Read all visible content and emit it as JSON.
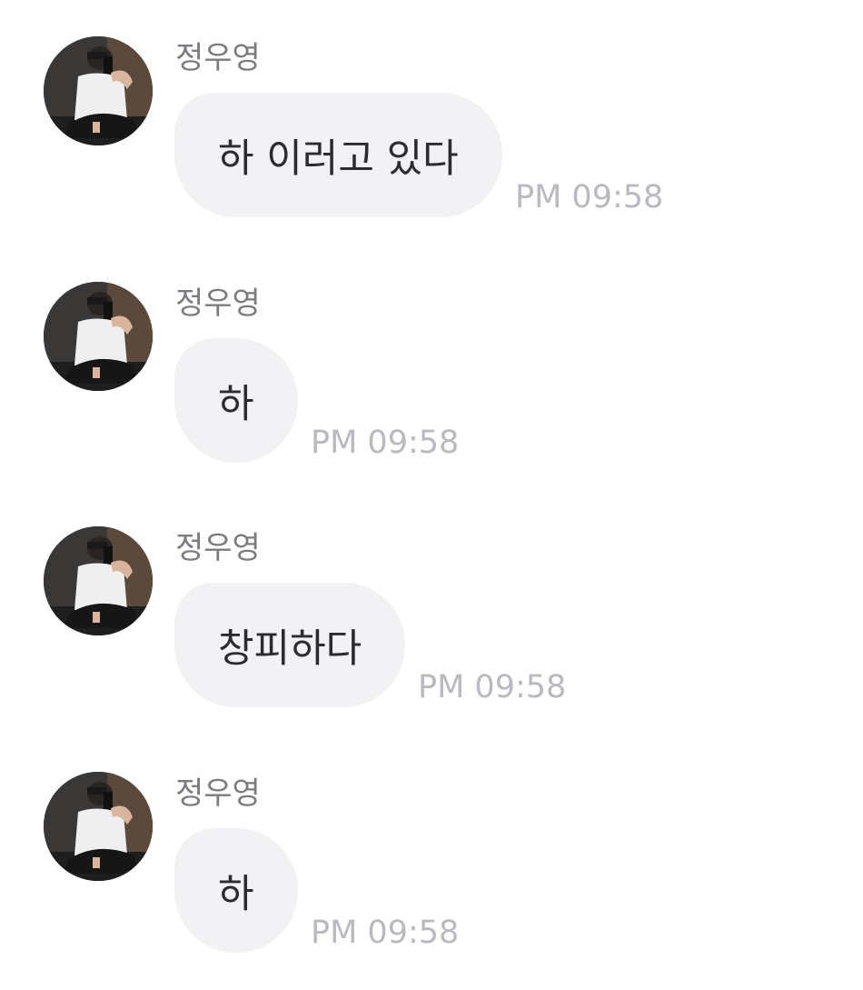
{
  "messages": [
    {
      "sender": "정우영",
      "text": "하 이러고 있다",
      "time": "PM 09:58"
    },
    {
      "sender": "정우영",
      "text": "하",
      "time": "PM 09:58"
    },
    {
      "sender": "정우영",
      "text": "창피하다",
      "time": "PM 09:58"
    },
    {
      "sender": "정우영",
      "text": "하",
      "time": "PM 09:58"
    }
  ],
  "colors": {
    "bubble": "#f2f2f4",
    "sender": "#7b7b80",
    "time": "#b9b9bf",
    "text": "#2b2b30"
  }
}
